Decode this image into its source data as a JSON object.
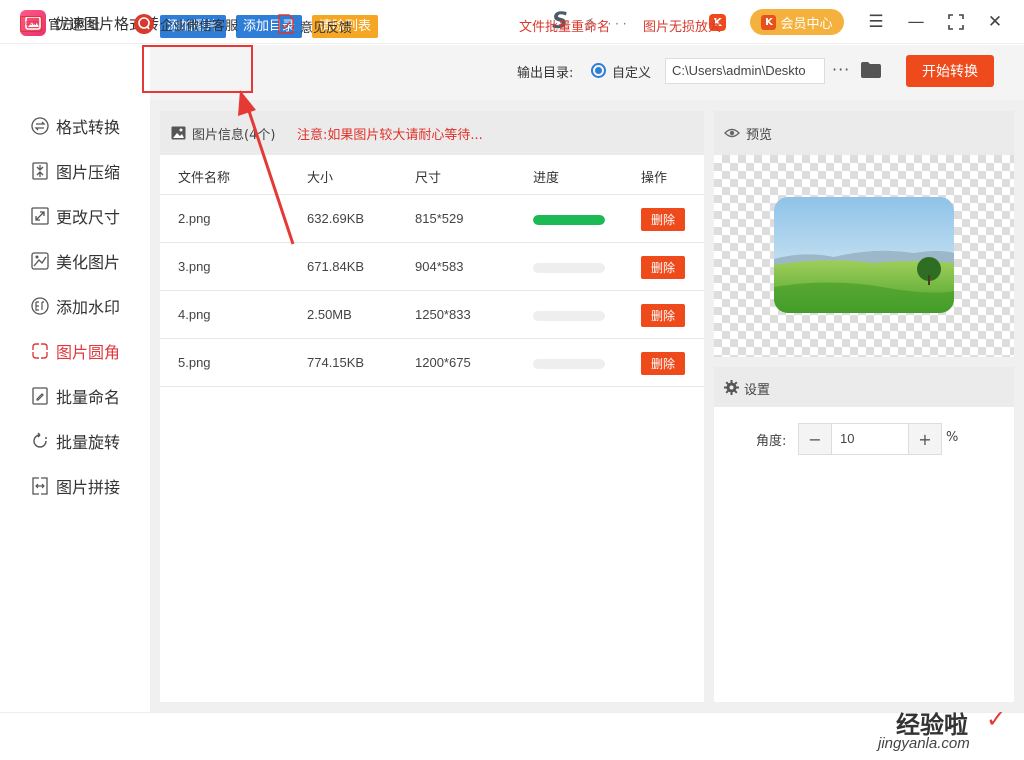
{
  "app": {
    "title": "优速图片格式转换器",
    "user_name": "彡 ·  ·  ·  ·",
    "vip_label": "会员中心",
    "vip_icon_letter": "K",
    "v_mark": "K"
  },
  "window_controls": {
    "menu": "☰",
    "minimize": "—",
    "maximize": "⛶",
    "close": "✕"
  },
  "toolbar": {
    "add_image": "添加图片",
    "add_dir": "添加目录",
    "clear_list": "清除列表",
    "output_label": "输出目录:",
    "custom_label": "自定义",
    "output_path": "C:\\Users\\admin\\Deskto",
    "more": "···",
    "start": "开始转换"
  },
  "sidebar": {
    "items": [
      {
        "label": "格式转换",
        "icon": "format-convert-icon"
      },
      {
        "label": "图片压缩",
        "icon": "compress-icon"
      },
      {
        "label": "更改尺寸",
        "icon": "resize-icon"
      },
      {
        "label": "美化图片",
        "icon": "beautify-icon"
      },
      {
        "label": "添加水印",
        "icon": "watermark-icon"
      },
      {
        "label": "图片圆角",
        "icon": "round-corner-icon",
        "active": true
      },
      {
        "label": "批量命名",
        "icon": "rename-icon"
      },
      {
        "label": "批量旋转",
        "icon": "rotate-icon"
      },
      {
        "label": "图片拼接",
        "icon": "stitch-icon"
      }
    ]
  },
  "file_panel": {
    "title": "图片信息(4个)",
    "warning": "注意:如果图片较大请耐心等待...",
    "columns": [
      "文件名称",
      "大小",
      "尺寸",
      "进度",
      "操作"
    ],
    "rows": [
      {
        "name": "2.png",
        "size": "632.69KB",
        "dims": "815*529",
        "progress": 1.0,
        "action": "删除"
      },
      {
        "name": "3.png",
        "size": "671.84KB",
        "dims": "904*583",
        "progress": 0.0,
        "action": "删除"
      },
      {
        "name": "4.png",
        "size": "2.50MB",
        "dims": "1250*833",
        "progress": 0.0,
        "action": "删除"
      },
      {
        "name": "5.png",
        "size": "774.15KB",
        "dims": "1200*675",
        "progress": 0.0,
        "action": "删除"
      }
    ]
  },
  "preview": {
    "title": "预览"
  },
  "settings": {
    "title": "设置",
    "angle_label": "角度:",
    "angle_value": "10",
    "minus": "−",
    "plus": "+",
    "unit": "%"
  },
  "footer": {
    "website": "官方网址",
    "website_icon_text": ".com",
    "wechat": "企业微信客服",
    "feedback": "意见反馈",
    "link_rename": "文件批量重命名",
    "link_enlarge": "图片无损放大",
    "watermark_cn": "经验啦",
    "watermark_en": "jingyanla.com",
    "watermark_check": "✓"
  },
  "colors": {
    "blue_button": "#2e7dd7",
    "orange_button": "#f5a623",
    "start_button": "#ee4a1c",
    "progress_done": "#1db954",
    "active_sidebar": "#e0393e"
  }
}
